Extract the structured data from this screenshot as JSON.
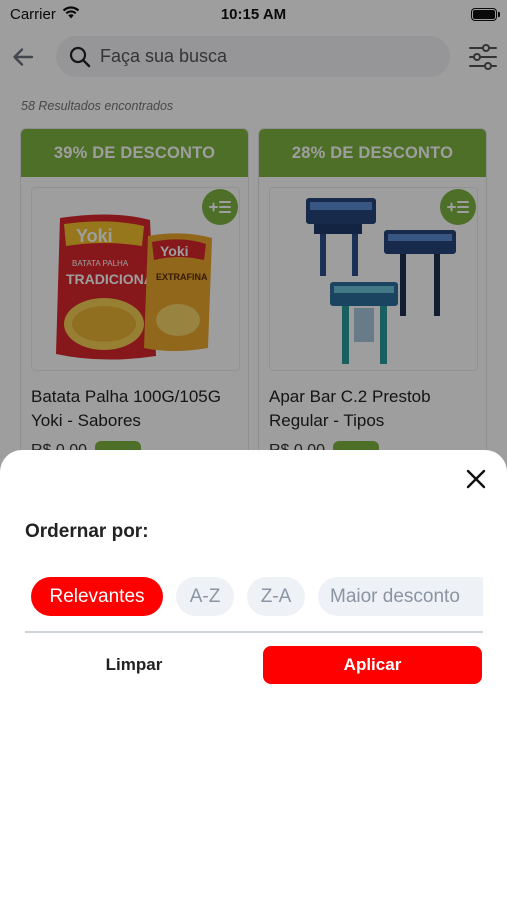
{
  "status_bar": {
    "carrier": "Carrier",
    "time": "10:15 AM"
  },
  "header": {
    "search_placeholder": "Faça sua busca"
  },
  "results": {
    "count_text": "58 Resultados encontrados"
  },
  "products": [
    {
      "discount": "39% DE DESCONTO",
      "name": "Batata Palha 100G/105G Yoki - Sabores",
      "price": "R$ 0,00",
      "image_text": {
        "brand": "Yoki",
        "line1": "BATATA PALHA",
        "line2": "TRADICIONAL",
        "brand2": "Yoki",
        "line3": "EXTRAFINA"
      }
    },
    {
      "discount": "28% DE DESCONTO",
      "name": "Apar Bar C.2 Prestob Regular - Tipos",
      "price": "R$ 0,00"
    }
  ],
  "sort_sheet": {
    "title": "Ordernar por:",
    "options": [
      {
        "label": "Relevantes",
        "selected": true
      },
      {
        "label": "A-Z",
        "selected": false
      },
      {
        "label": "Z-A",
        "selected": false
      },
      {
        "label": "Maior desconto",
        "selected": false
      }
    ],
    "clear_label": "Limpar",
    "apply_label": "Aplicar"
  },
  "colors": {
    "accent_red": "#ff0000",
    "discount_green": "#7cb342",
    "chip_bg": "#eef1f6",
    "chip_text": "#8a94a3"
  },
  "icons": [
    "wifi-icon",
    "battery-icon",
    "back-arrow-icon",
    "search-icon",
    "filter-icon",
    "add-to-list-icon",
    "close-icon"
  ]
}
